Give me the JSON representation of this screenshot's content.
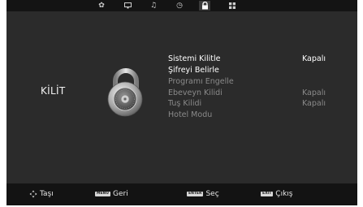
{
  "tabs": [
    {
      "icon": "picture-icon",
      "glyph": "✿",
      "active": false
    },
    {
      "icon": "monitor-icon",
      "glyph": "🖵",
      "active": false
    },
    {
      "icon": "music-icon",
      "glyph": "♫",
      "active": false
    },
    {
      "icon": "clock-icon",
      "glyph": "◷",
      "active": false
    },
    {
      "icon": "lock-icon",
      "glyph": "🔒",
      "active": true
    },
    {
      "icon": "settings-grid-icon",
      "glyph": "▦",
      "active": false
    }
  ],
  "section_title": "KİLİT",
  "menu": [
    {
      "label": "Sistemi Kilitle",
      "value": "Kapalı",
      "enabled": true
    },
    {
      "label": "Şifreyi Belirle",
      "value": "",
      "enabled": true
    },
    {
      "label": "Programı Engelle",
      "value": "",
      "enabled": false
    },
    {
      "label": "Ebeveyn Kilidi",
      "value": "Kapalı",
      "enabled": false
    },
    {
      "label": "Tuş Kilidi",
      "value": "Kapalı",
      "enabled": false
    },
    {
      "label": "Hotel Modu",
      "value": "",
      "enabled": false
    }
  ],
  "hints": {
    "move": {
      "label": "Taşı"
    },
    "back": {
      "key": "MENU",
      "label": "Geri"
    },
    "select": {
      "key": "ENTER",
      "label": "Seç"
    },
    "exit": {
      "key": "EXIT",
      "label": "Çıkış"
    }
  }
}
